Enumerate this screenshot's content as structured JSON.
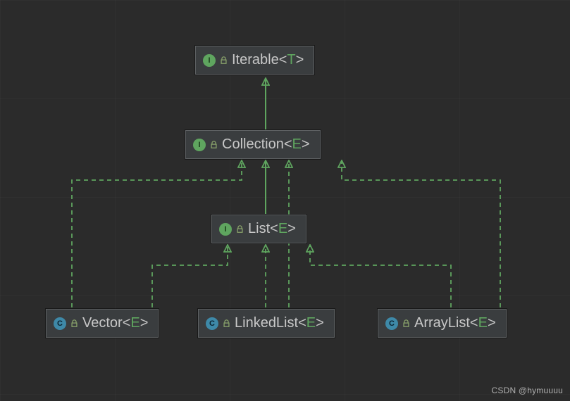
{
  "nodes": {
    "iterable": {
      "kind": "I",
      "name": "Iterable",
      "generic": "T"
    },
    "collection": {
      "kind": "I",
      "name": "Collection",
      "generic": "E"
    },
    "list": {
      "kind": "I",
      "name": "List",
      "generic": "E"
    },
    "vector": {
      "kind": "C",
      "name": "Vector",
      "generic": "E"
    },
    "linkedlist": {
      "kind": "C",
      "name": "LinkedList",
      "generic": "E"
    },
    "arraylist": {
      "kind": "C",
      "name": "ArrayList",
      "generic": "E"
    }
  },
  "icons": {
    "interface_letter": "I",
    "class_letter": "C"
  },
  "colors": {
    "background": "#2b2b2b",
    "node_bg": "#3a3d3f",
    "node_border": "#5e6163",
    "text": "#c8c8c8",
    "generic": "#5fa55f",
    "edge_solid": "#5fa55f",
    "edge_dashed": "#5fa55f",
    "interface_badge": "#5fa55f",
    "class_badge": "#3e89a8"
  },
  "edges": [
    {
      "from": "collection",
      "to": "iterable",
      "style": "solid"
    },
    {
      "from": "list",
      "to": "collection",
      "style": "solid"
    },
    {
      "from": "vector",
      "to": "list",
      "style": "dashed"
    },
    {
      "from": "linkedlist",
      "to": "list",
      "style": "dashed"
    },
    {
      "from": "arraylist",
      "to": "list",
      "style": "dashed"
    },
    {
      "from": "vector",
      "to": "collection",
      "style": "dashed"
    },
    {
      "from": "linkedlist",
      "to": "collection",
      "style": "dashed"
    },
    {
      "from": "arraylist",
      "to": "collection",
      "style": "dashed"
    }
  ],
  "watermark": "CSDN @hymuuuu"
}
